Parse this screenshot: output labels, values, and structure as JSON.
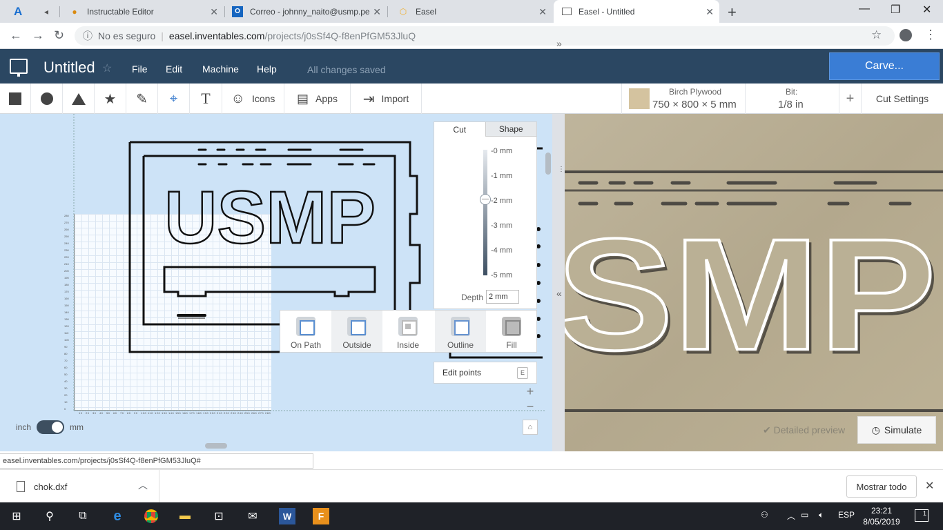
{
  "browser": {
    "tabs": [
      {
        "title": "",
        "icon": "autodesk-icon"
      },
      {
        "title": "",
        "icon": "speaker-icon"
      },
      {
        "title": "Instructable Editor",
        "icon": "instructables-icon"
      },
      {
        "title": "Correo - johnny_naito@usmp.pe",
        "icon": "outlook-icon"
      },
      {
        "title": "Easel",
        "icon": "easel-icon"
      },
      {
        "title": "Easel - Untitled",
        "icon": "page-icon",
        "active": true
      }
    ],
    "security": "No es seguro",
    "url_host": "easel.inventables.com",
    "url_path": "/projects/j0sSf4Q-f8enPfGM53JluQ"
  },
  "header": {
    "title": "Untitled",
    "menus": [
      "File",
      "Edit",
      "Machine",
      "Help"
    ],
    "save_status": "All changes saved",
    "carve_label": "Carve..."
  },
  "toolbar": {
    "icons_label": "Icons",
    "apps_label": "Apps",
    "import_label": "Import",
    "text_tool": "T",
    "material_name": "Birch Plywood",
    "material_dims": "750 × 800 × 5 mm",
    "bit_label": "Bit:",
    "bit_value": "1/8 in",
    "add_label": "+",
    "cut_settings": "Cut Settings"
  },
  "canvas": {
    "unit_left": "inch",
    "unit_right": "mm",
    "design_text": "USMP"
  },
  "cut_panel": {
    "tab_cut": "Cut",
    "tab_shape": "Shape",
    "ticks": [
      "-0 mm",
      "-1 mm",
      "-2 mm",
      "-3 mm",
      "-4 mm",
      "-5 mm"
    ],
    "selected_depth_mm": 2,
    "depth_label": "Depth",
    "depth_value": "2 mm",
    "types": [
      "On Path",
      "Outside",
      "Inside",
      "Outline",
      "Fill"
    ],
    "edit_points": "Edit points",
    "edit_key": "E"
  },
  "preview": {
    "text": "SMP",
    "detailed_preview": "Detailed preview",
    "simulate": "Simulate"
  },
  "status_url": "easel.inventables.com/projects/j0sSf4Q-f8enPfGM53JluQ#",
  "downloads": {
    "file": "chok.dxf",
    "show_all": "Mostrar todo"
  },
  "taskbar": {
    "lang": "ESP",
    "time": "23:21",
    "date": "8/05/2019",
    "notifications": "1"
  },
  "colors": {
    "header_bg": "#2b4762",
    "carve_btn": "#3a7dd5",
    "canvas_bg": "#cde3f7",
    "wood": "#b9ae94"
  }
}
